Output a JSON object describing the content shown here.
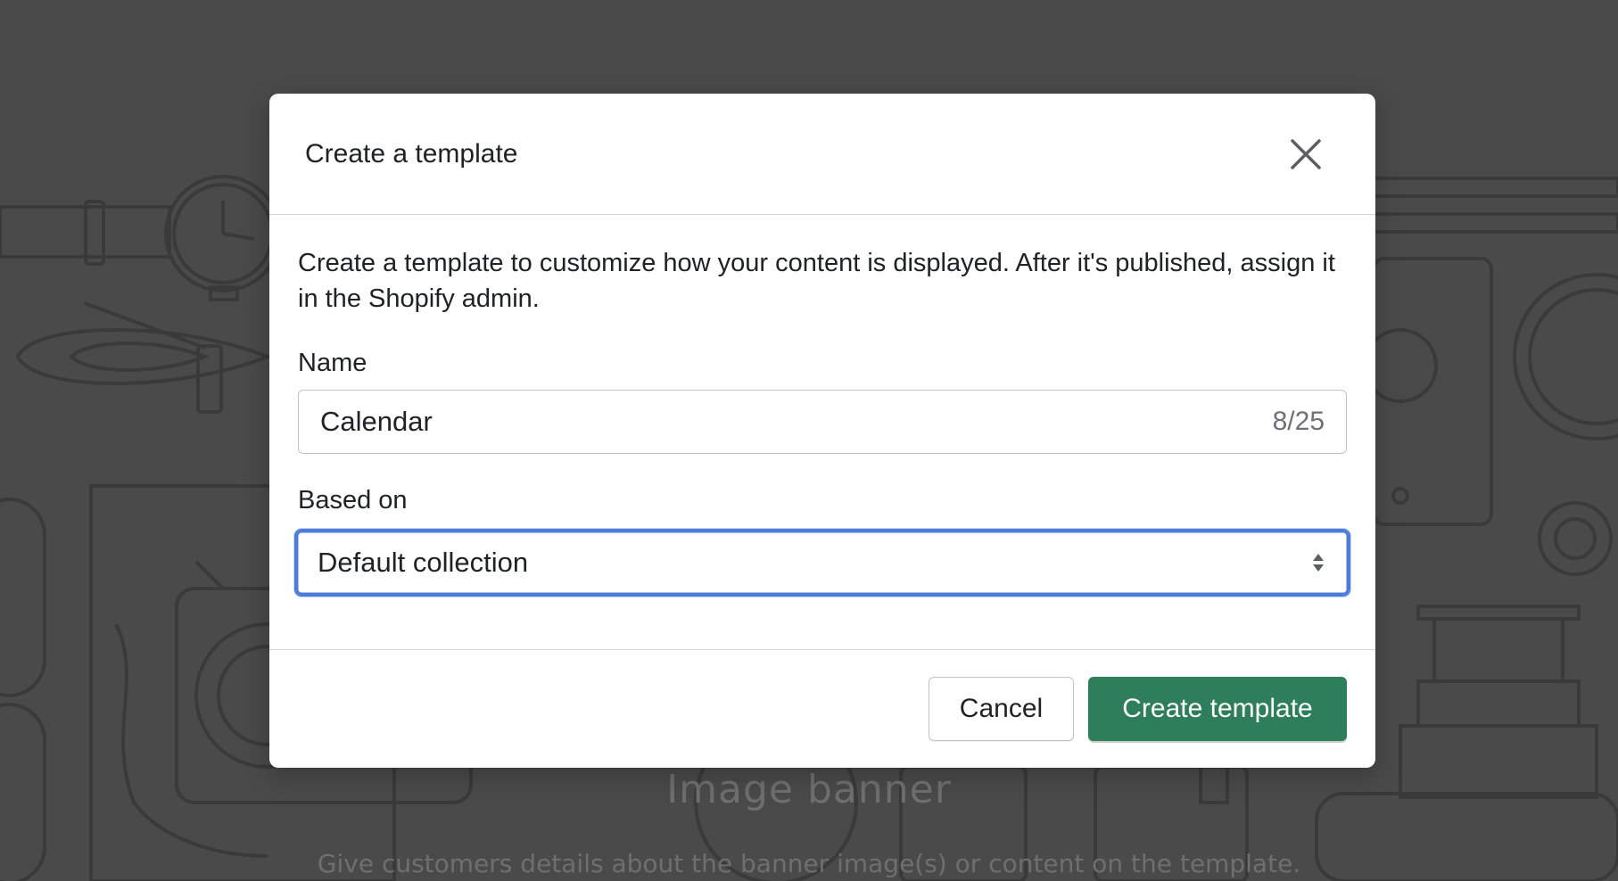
{
  "background": {
    "title": "Image banner",
    "subtitle": "Give customers details about the banner image(s) or content on the template."
  },
  "modal": {
    "title": "Create a template",
    "description": "Create a template to customize how your content is displayed. After it's published, assign it in the Shopify admin.",
    "name_field": {
      "label": "Name",
      "value": "Calendar",
      "char_count": "8/25"
    },
    "based_on_field": {
      "label": "Based on",
      "selected": "Default collection"
    },
    "buttons": {
      "cancel": "Cancel",
      "create": "Create template"
    }
  },
  "colors": {
    "primary": "#2e7d5b",
    "focus": "#4f7bd8",
    "overlay": "#4a4a4a"
  },
  "icons": {
    "close": "close-icon",
    "select": "select-arrows-icon"
  }
}
